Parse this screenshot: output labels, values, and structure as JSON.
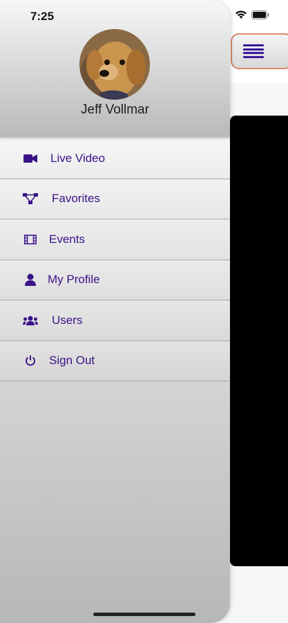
{
  "status_bar": {
    "time": "7:25"
  },
  "profile": {
    "name": "Jeff Vollmar"
  },
  "menu": {
    "items": [
      {
        "label": "Live Video",
        "icon": "video-camera-icon"
      },
      {
        "label": "Favorites",
        "icon": "nodes-icon"
      },
      {
        "label": "Events",
        "icon": "film-icon"
      },
      {
        "label": "My Profile",
        "icon": "user-icon"
      },
      {
        "label": "Users",
        "icon": "users-icon"
      },
      {
        "label": "Sign Out",
        "icon": "power-icon"
      }
    ]
  },
  "colors": {
    "accent": "#3a1288",
    "menu_button_border": "#d9896a"
  }
}
